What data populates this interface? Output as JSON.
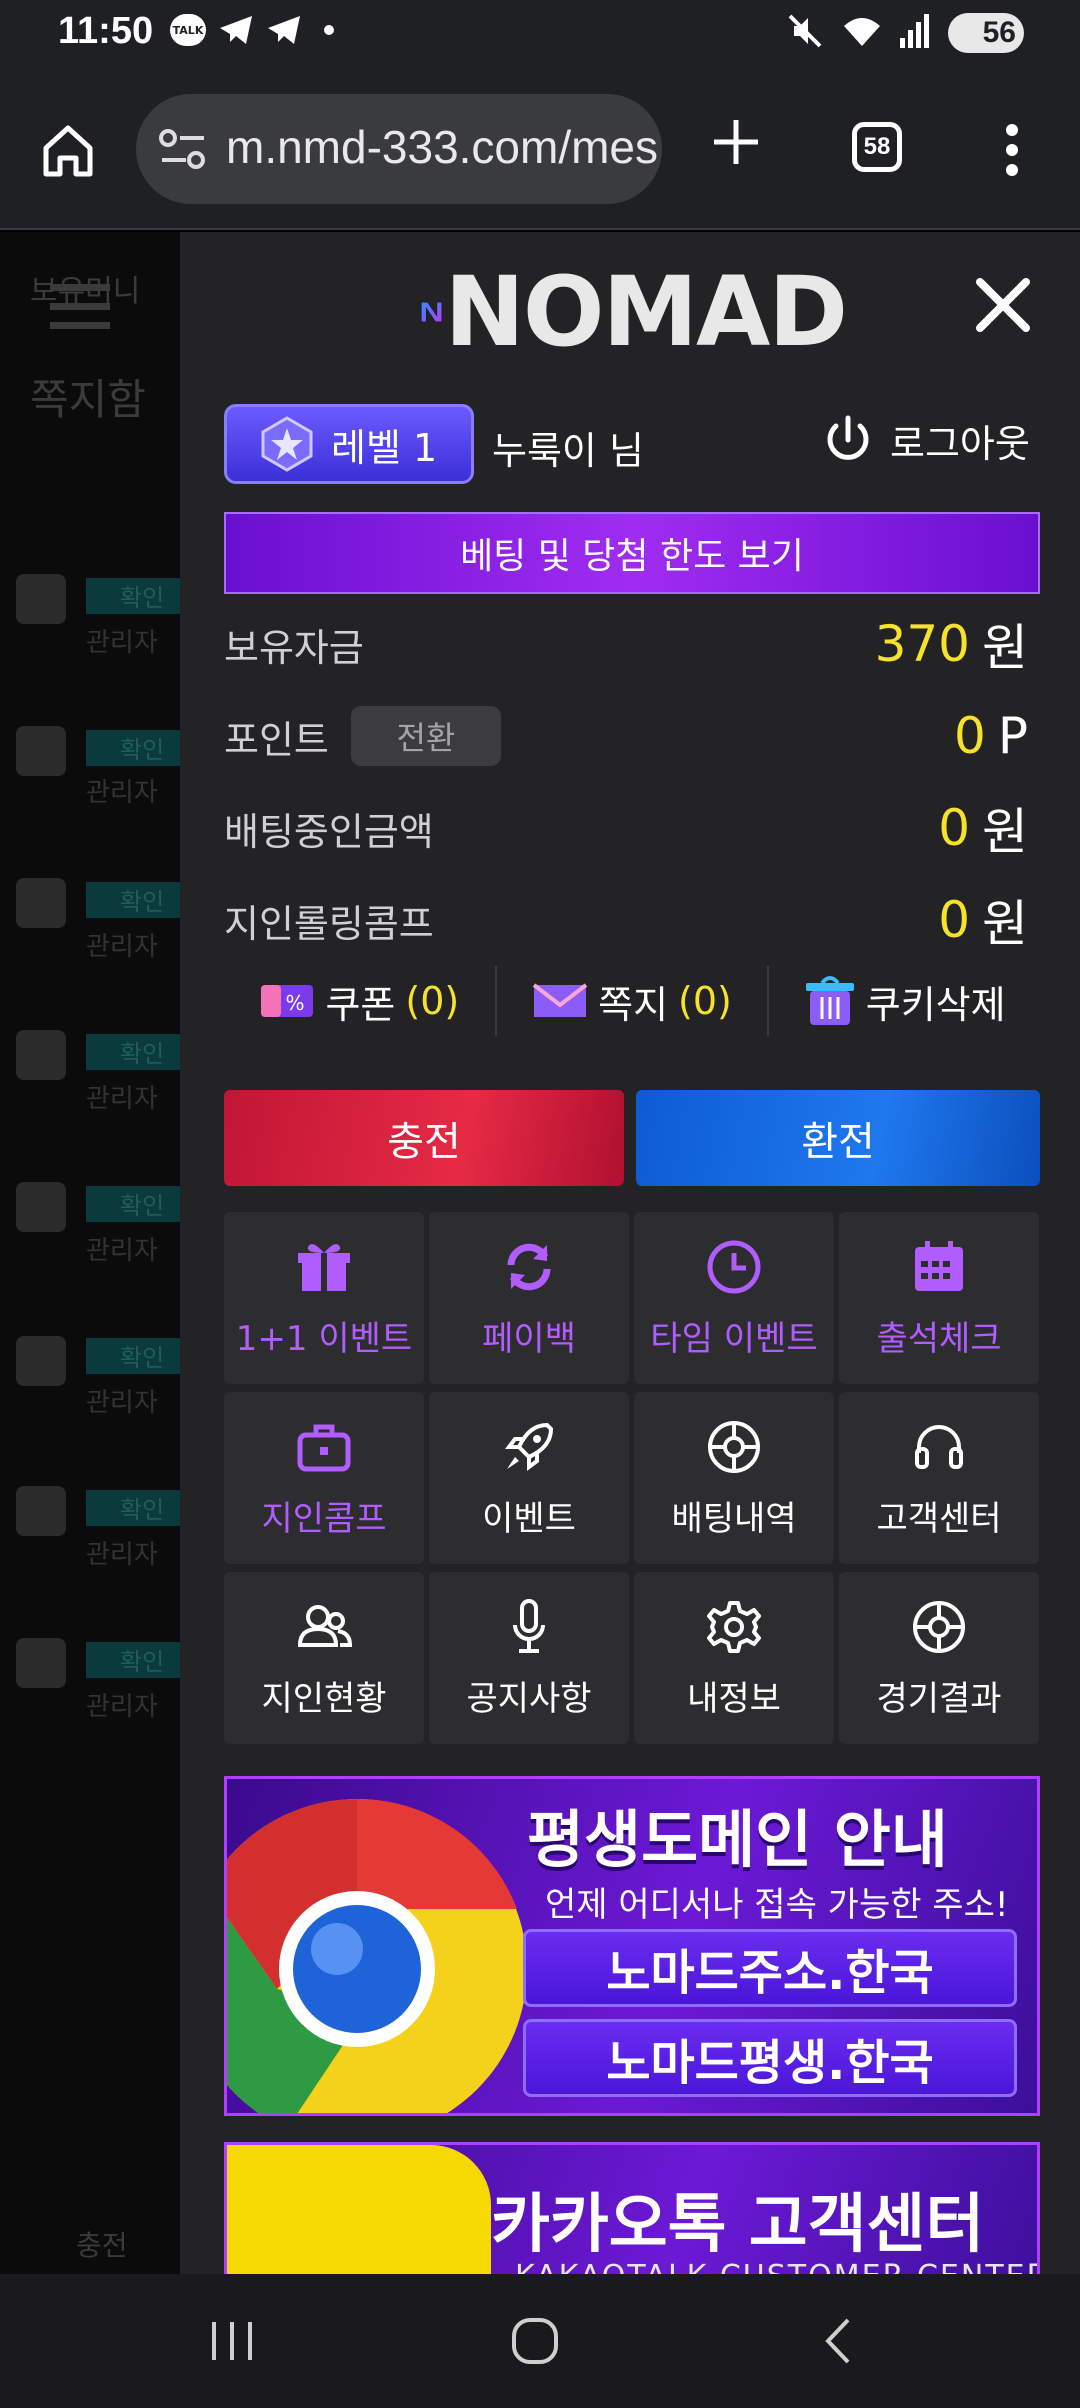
{
  "status_bar": {
    "time": "11:50",
    "talk_icon_text": "TALK",
    "battery": "56"
  },
  "browser": {
    "url": "m.nmd-333.com/mes",
    "tab_count": "58"
  },
  "background_page": {
    "balance_label": "보유머니",
    "inbox_title": "쪽지함",
    "badge_label": "확인",
    "sender_label": "관리자",
    "charge_label": "충전"
  },
  "panel": {
    "logo": "NOMAD",
    "level": "레벨 1",
    "user_name": "누룩이 님",
    "logout": "로그아웃",
    "limit_button": "베팅 및 당첨 한도 보기",
    "money": [
      {
        "label": "보유자금",
        "value": "370",
        "unit": "원"
      },
      {
        "label": "포인트",
        "value": "0",
        "unit": "P",
        "button": "전환"
      },
      {
        "label": "배팅중인금액",
        "value": "0",
        "unit": "원"
      },
      {
        "label": "지인롤링콤프",
        "value": "0",
        "unit": "원"
      }
    ],
    "tools": {
      "coupon": "쿠폰",
      "coupon_count": "(0)",
      "message": "쪽지",
      "message_count": "(0)",
      "cookie": "쿠키삭제"
    },
    "charge": "충전",
    "exchange": "환전",
    "menu": [
      {
        "label": "1+1 이벤트",
        "icon": "gift-icon",
        "purple": true
      },
      {
        "label": "페이백",
        "icon": "refresh-icon",
        "purple": true
      },
      {
        "label": "타임 이벤트",
        "icon": "clock-icon",
        "purple": true
      },
      {
        "label": "출석체크",
        "icon": "calendar-icon",
        "purple": true
      },
      {
        "label": "지인콤프",
        "icon": "briefcase-icon",
        "purple": true
      },
      {
        "label": "이벤트",
        "icon": "rocket-icon",
        "purple": false
      },
      {
        "label": "배팅내역",
        "icon": "ball-icon",
        "purple": false
      },
      {
        "label": "고객센터",
        "icon": "headset-icon",
        "purple": false
      },
      {
        "label": "지인현황",
        "icon": "users-icon",
        "purple": false
      },
      {
        "label": "공지사항",
        "icon": "microphone-icon",
        "purple": false
      },
      {
        "label": "내정보",
        "icon": "gear-icon",
        "purple": false
      },
      {
        "label": "경기결과",
        "icon": "ball-icon",
        "purple": false
      }
    ],
    "banner1": {
      "title": "평생도메인 안내",
      "subtitle": "언제 어디서나 접속 가능한 주소!",
      "domains": [
        "노마드주소.한국",
        "노마드평생.한국"
      ]
    },
    "banner2": {
      "title": "카카오톡 고객센터",
      "subtitle": "KAKAOTALK CUSTOMER CENTER"
    }
  },
  "colors": {
    "accent_yellow": "#f6e12b",
    "menu_purple": "#b15cff",
    "charge_red": "#e62a45",
    "exchange_blue": "#1f78ee"
  }
}
